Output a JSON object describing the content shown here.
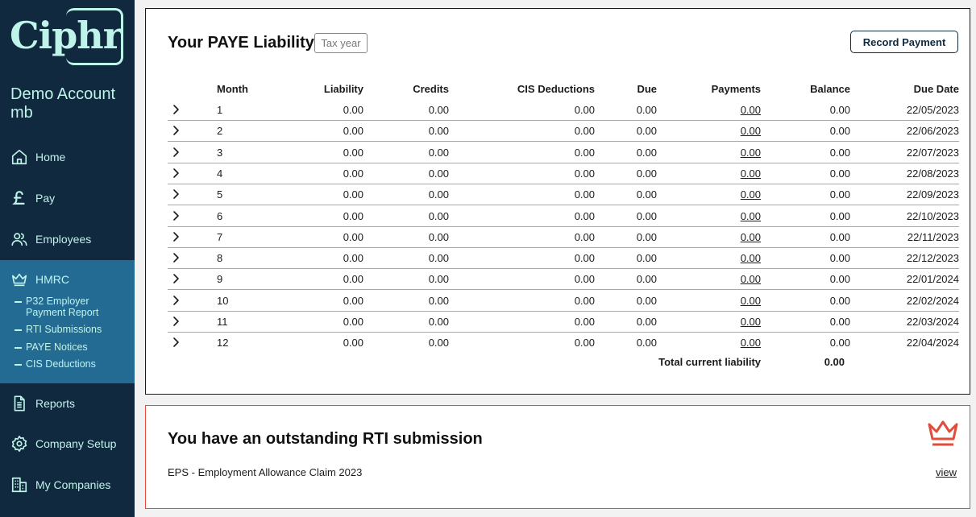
{
  "sidebar": {
    "logo_text": "Ciphr",
    "account_name": "Demo Account mb",
    "nav": [
      {
        "label": "Home",
        "icon": "home-icon"
      },
      {
        "label": "Pay",
        "icon": "pound-icon"
      },
      {
        "label": "Employees",
        "icon": "people-icon"
      },
      {
        "label": "HMRC",
        "icon": "crown-icon"
      },
      {
        "label": "Reports",
        "icon": "document-icon"
      },
      {
        "label": "Company Setup",
        "icon": "gear-icon"
      },
      {
        "label": "My Companies",
        "icon": "building-icon"
      }
    ],
    "hmrc_sub": [
      {
        "label": "P32 Employer Payment Report"
      },
      {
        "label": "RTI Submissions"
      },
      {
        "label": "PAYE Notices"
      },
      {
        "label": "CIS Deductions"
      }
    ]
  },
  "liability": {
    "title": "Your PAYE Liability",
    "tax_year_placeholder": "Tax year",
    "record_button": "Record Payment",
    "columns": {
      "month": "Month",
      "liability": "Liability",
      "credits": "Credits",
      "cis": "CIS Deductions",
      "due": "Due",
      "payments": "Payments",
      "balance": "Balance",
      "due_date": "Due Date"
    },
    "rows": [
      {
        "month": "1",
        "liability": "0.00",
        "credits": "0.00",
        "cis": "0.00",
        "due": "0.00",
        "payments": "0.00",
        "balance": "0.00",
        "due_date": "22/05/2023"
      },
      {
        "month": "2",
        "liability": "0.00",
        "credits": "0.00",
        "cis": "0.00",
        "due": "0.00",
        "payments": "0.00",
        "balance": "0.00",
        "due_date": "22/06/2023"
      },
      {
        "month": "3",
        "liability": "0.00",
        "credits": "0.00",
        "cis": "0.00",
        "due": "0.00",
        "payments": "0.00",
        "balance": "0.00",
        "due_date": "22/07/2023"
      },
      {
        "month": "4",
        "liability": "0.00",
        "credits": "0.00",
        "cis": "0.00",
        "due": "0.00",
        "payments": "0.00",
        "balance": "0.00",
        "due_date": "22/08/2023"
      },
      {
        "month": "5",
        "liability": "0.00",
        "credits": "0.00",
        "cis": "0.00",
        "due": "0.00",
        "payments": "0.00",
        "balance": "0.00",
        "due_date": "22/09/2023"
      },
      {
        "month": "6",
        "liability": "0.00",
        "credits": "0.00",
        "cis": "0.00",
        "due": "0.00",
        "payments": "0.00",
        "balance": "0.00",
        "due_date": "22/10/2023"
      },
      {
        "month": "7",
        "liability": "0.00",
        "credits": "0.00",
        "cis": "0.00",
        "due": "0.00",
        "payments": "0.00",
        "balance": "0.00",
        "due_date": "22/11/2023"
      },
      {
        "month": "8",
        "liability": "0.00",
        "credits": "0.00",
        "cis": "0.00",
        "due": "0.00",
        "payments": "0.00",
        "balance": "0.00",
        "due_date": "22/12/2023"
      },
      {
        "month": "9",
        "liability": "0.00",
        "credits": "0.00",
        "cis": "0.00",
        "due": "0.00",
        "payments": "0.00",
        "balance": "0.00",
        "due_date": "22/01/2024"
      },
      {
        "month": "10",
        "liability": "0.00",
        "credits": "0.00",
        "cis": "0.00",
        "due": "0.00",
        "payments": "0.00",
        "balance": "0.00",
        "due_date": "22/02/2024"
      },
      {
        "month": "11",
        "liability": "0.00",
        "credits": "0.00",
        "cis": "0.00",
        "due": "0.00",
        "payments": "0.00",
        "balance": "0.00",
        "due_date": "22/03/2024"
      },
      {
        "month": "12",
        "liability": "0.00",
        "credits": "0.00",
        "cis": "0.00",
        "due": "0.00",
        "payments": "0.00",
        "balance": "0.00",
        "due_date": "22/04/2024"
      }
    ],
    "total_label": "Total current liability",
    "total_value": "0.00"
  },
  "rti": {
    "title": "You have an outstanding RTI submission",
    "description": "EPS - Employment Allowance Claim 2023",
    "view_label": "view",
    "icon": "crown-icon",
    "accent": "#e24c3b"
  },
  "colors": {
    "sidebar_bg": "#10293e",
    "sidebar_active_bg": "#246b94",
    "sidebar_text": "#bff4ea"
  }
}
